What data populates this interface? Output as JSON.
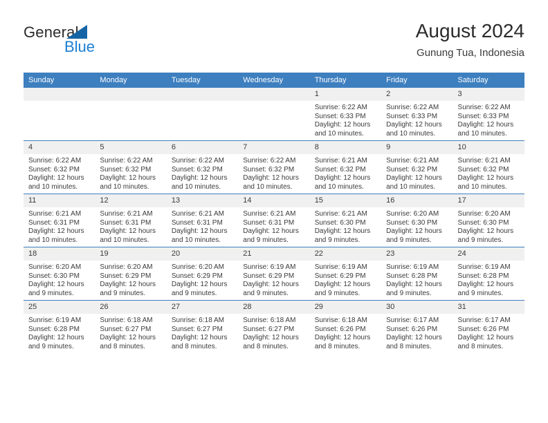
{
  "logo": {
    "word1": "General",
    "word2": "Blue",
    "triangle_color": "#1565a6",
    "blue_color": "#1a7fd4"
  },
  "header": {
    "title": "August 2024",
    "subtitle": "Gunung Tua, Indonesia"
  },
  "theme": {
    "header_row_bg": "#3d7fbf",
    "daynum_bg": "#f0f0f0",
    "text": "#3a3a3a"
  },
  "weekday_headers": [
    "Sunday",
    "Monday",
    "Tuesday",
    "Wednesday",
    "Thursday",
    "Friday",
    "Saturday"
  ],
  "labels": {
    "sunrise": "Sunrise:",
    "sunset": "Sunset:",
    "daylight": "Daylight:"
  },
  "weeks": [
    [
      {
        "day": "",
        "empty": true
      },
      {
        "day": "",
        "empty": true
      },
      {
        "day": "",
        "empty": true
      },
      {
        "day": "",
        "empty": true
      },
      {
        "day": "1",
        "sunrise": "Sunrise: 6:22 AM",
        "sunset": "Sunset: 6:33 PM",
        "daylight": "Daylight: 12 hours and 10 minutes."
      },
      {
        "day": "2",
        "sunrise": "Sunrise: 6:22 AM",
        "sunset": "Sunset: 6:33 PM",
        "daylight": "Daylight: 12 hours and 10 minutes."
      },
      {
        "day": "3",
        "sunrise": "Sunrise: 6:22 AM",
        "sunset": "Sunset: 6:33 PM",
        "daylight": "Daylight: 12 hours and 10 minutes."
      }
    ],
    [
      {
        "day": "4",
        "sunrise": "Sunrise: 6:22 AM",
        "sunset": "Sunset: 6:32 PM",
        "daylight": "Daylight: 12 hours and 10 minutes."
      },
      {
        "day": "5",
        "sunrise": "Sunrise: 6:22 AM",
        "sunset": "Sunset: 6:32 PM",
        "daylight": "Daylight: 12 hours and 10 minutes."
      },
      {
        "day": "6",
        "sunrise": "Sunrise: 6:22 AM",
        "sunset": "Sunset: 6:32 PM",
        "daylight": "Daylight: 12 hours and 10 minutes."
      },
      {
        "day": "7",
        "sunrise": "Sunrise: 6:22 AM",
        "sunset": "Sunset: 6:32 PM",
        "daylight": "Daylight: 12 hours and 10 minutes."
      },
      {
        "day": "8",
        "sunrise": "Sunrise: 6:21 AM",
        "sunset": "Sunset: 6:32 PM",
        "daylight": "Daylight: 12 hours and 10 minutes."
      },
      {
        "day": "9",
        "sunrise": "Sunrise: 6:21 AM",
        "sunset": "Sunset: 6:32 PM",
        "daylight": "Daylight: 12 hours and 10 minutes."
      },
      {
        "day": "10",
        "sunrise": "Sunrise: 6:21 AM",
        "sunset": "Sunset: 6:32 PM",
        "daylight": "Daylight: 12 hours and 10 minutes."
      }
    ],
    [
      {
        "day": "11",
        "sunrise": "Sunrise: 6:21 AM",
        "sunset": "Sunset: 6:31 PM",
        "daylight": "Daylight: 12 hours and 10 minutes."
      },
      {
        "day": "12",
        "sunrise": "Sunrise: 6:21 AM",
        "sunset": "Sunset: 6:31 PM",
        "daylight": "Daylight: 12 hours and 10 minutes."
      },
      {
        "day": "13",
        "sunrise": "Sunrise: 6:21 AM",
        "sunset": "Sunset: 6:31 PM",
        "daylight": "Daylight: 12 hours and 10 minutes."
      },
      {
        "day": "14",
        "sunrise": "Sunrise: 6:21 AM",
        "sunset": "Sunset: 6:31 PM",
        "daylight": "Daylight: 12 hours and 9 minutes."
      },
      {
        "day": "15",
        "sunrise": "Sunrise: 6:21 AM",
        "sunset": "Sunset: 6:30 PM",
        "daylight": "Daylight: 12 hours and 9 minutes."
      },
      {
        "day": "16",
        "sunrise": "Sunrise: 6:20 AM",
        "sunset": "Sunset: 6:30 PM",
        "daylight": "Daylight: 12 hours and 9 minutes."
      },
      {
        "day": "17",
        "sunrise": "Sunrise: 6:20 AM",
        "sunset": "Sunset: 6:30 PM",
        "daylight": "Daylight: 12 hours and 9 minutes."
      }
    ],
    [
      {
        "day": "18",
        "sunrise": "Sunrise: 6:20 AM",
        "sunset": "Sunset: 6:30 PM",
        "daylight": "Daylight: 12 hours and 9 minutes."
      },
      {
        "day": "19",
        "sunrise": "Sunrise: 6:20 AM",
        "sunset": "Sunset: 6:29 PM",
        "daylight": "Daylight: 12 hours and 9 minutes."
      },
      {
        "day": "20",
        "sunrise": "Sunrise: 6:20 AM",
        "sunset": "Sunset: 6:29 PM",
        "daylight": "Daylight: 12 hours and 9 minutes."
      },
      {
        "day": "21",
        "sunrise": "Sunrise: 6:19 AM",
        "sunset": "Sunset: 6:29 PM",
        "daylight": "Daylight: 12 hours and 9 minutes."
      },
      {
        "day": "22",
        "sunrise": "Sunrise: 6:19 AM",
        "sunset": "Sunset: 6:29 PM",
        "daylight": "Daylight: 12 hours and 9 minutes."
      },
      {
        "day": "23",
        "sunrise": "Sunrise: 6:19 AM",
        "sunset": "Sunset: 6:28 PM",
        "daylight": "Daylight: 12 hours and 9 minutes."
      },
      {
        "day": "24",
        "sunrise": "Sunrise: 6:19 AM",
        "sunset": "Sunset: 6:28 PM",
        "daylight": "Daylight: 12 hours and 9 minutes."
      }
    ],
    [
      {
        "day": "25",
        "sunrise": "Sunrise: 6:19 AM",
        "sunset": "Sunset: 6:28 PM",
        "daylight": "Daylight: 12 hours and 9 minutes."
      },
      {
        "day": "26",
        "sunrise": "Sunrise: 6:18 AM",
        "sunset": "Sunset: 6:27 PM",
        "daylight": "Daylight: 12 hours and 8 minutes."
      },
      {
        "day": "27",
        "sunrise": "Sunrise: 6:18 AM",
        "sunset": "Sunset: 6:27 PM",
        "daylight": "Daylight: 12 hours and 8 minutes."
      },
      {
        "day": "28",
        "sunrise": "Sunrise: 6:18 AM",
        "sunset": "Sunset: 6:27 PM",
        "daylight": "Daylight: 12 hours and 8 minutes."
      },
      {
        "day": "29",
        "sunrise": "Sunrise: 6:18 AM",
        "sunset": "Sunset: 6:26 PM",
        "daylight": "Daylight: 12 hours and 8 minutes."
      },
      {
        "day": "30",
        "sunrise": "Sunrise: 6:17 AM",
        "sunset": "Sunset: 6:26 PM",
        "daylight": "Daylight: 12 hours and 8 minutes."
      },
      {
        "day": "31",
        "sunrise": "Sunrise: 6:17 AM",
        "sunset": "Sunset: 6:26 PM",
        "daylight": "Daylight: 12 hours and 8 minutes."
      }
    ]
  ]
}
